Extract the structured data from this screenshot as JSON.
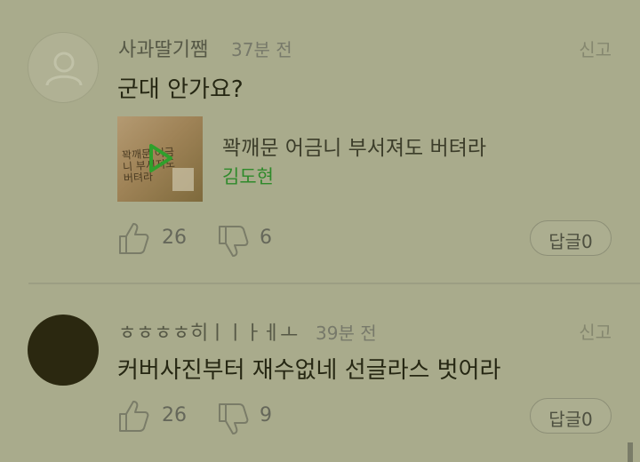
{
  "comments": [
    {
      "username": "사과딸기쨈",
      "time": "37분 전",
      "report_label": "신고",
      "content": "군대 안가요?",
      "music": {
        "title": "꽉깨문 어금니 부서져도 버텨라",
        "artist": "김도현",
        "cover_text": "꽉깨문 어금니 부서져도 버텨라"
      },
      "likes": "26",
      "dislikes": "6",
      "reply_label": "답글0"
    },
    {
      "username": "ㅎㅎㅎㅎ히ㅣㅣㅏㅔㅗ",
      "time": "39분 전",
      "report_label": "신고",
      "content": "커버사진부터 재수없네 선글라스 벗어라",
      "likes": "26",
      "dislikes": "9",
      "reply_label": "답글0"
    }
  ],
  "colors": {
    "background": "#a9ab8c",
    "accent_green": "#2f8a2b",
    "text_dark": "#262713"
  },
  "icons": [
    "person-avatar-icon",
    "play-icon",
    "thumbs-up-icon",
    "thumbs-down-icon"
  ]
}
